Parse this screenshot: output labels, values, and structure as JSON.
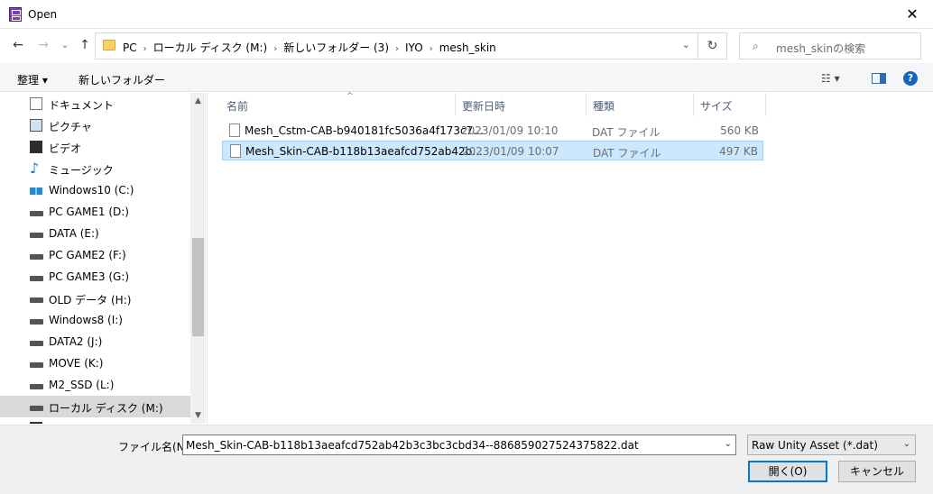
{
  "window": {
    "title": "Open",
    "close_glyph": "✕"
  },
  "nav": {
    "back": "←",
    "forward": "→",
    "recent": "⌄",
    "up": "↑",
    "breadcrumbs": [
      "PC",
      "ローカル ディスク (M:)",
      "新しいフォルダー (3)",
      "IYO",
      "mesh_skin"
    ],
    "separator": "›",
    "dropdown": "⌄",
    "refresh": "↻",
    "search_placeholder": "mesh_skinの検索",
    "search_glyph": "⌕"
  },
  "toolbar": {
    "organize": "整理 ▾",
    "new_folder": "新しいフォルダー",
    "view_glyph": "☷ ▾",
    "help": "?"
  },
  "sidebar": {
    "items": [
      {
        "label": "ドキュメント",
        "icon": "document-icon",
        "selected": false
      },
      {
        "label": "ピクチャ",
        "icon": "pictures-icon",
        "selected": false
      },
      {
        "label": "ビデオ",
        "icon": "videos-icon",
        "selected": false
      },
      {
        "label": "ミュージック",
        "icon": "music-icon",
        "selected": false
      },
      {
        "label": "Windows10 (C:)",
        "icon": "windows-drive-icon",
        "selected": false
      },
      {
        "label": "PC GAME1 (D:)",
        "icon": "drive-icon",
        "selected": false
      },
      {
        "label": "DATA (E:)",
        "icon": "drive-icon",
        "selected": false
      },
      {
        "label": "PC GAME2 (F:)",
        "icon": "drive-icon",
        "selected": false
      },
      {
        "label": "PC GAME3 (G:)",
        "icon": "drive-icon",
        "selected": false
      },
      {
        "label": "OLD データ (H:)",
        "icon": "drive-icon",
        "selected": false
      },
      {
        "label": "Windows8 (I:)",
        "icon": "drive-icon",
        "selected": false
      },
      {
        "label": "DATA2 (J:)",
        "icon": "drive-icon",
        "selected": false
      },
      {
        "label": "MOVE (K:)",
        "icon": "drive-icon",
        "selected": false
      },
      {
        "label": "M2_SSD (L:)",
        "icon": "drive-icon",
        "selected": false
      },
      {
        "label": "ローカル ディスク (M:)",
        "icon": "drive-icon",
        "selected": true
      }
    ],
    "scroll_up": "▲",
    "scroll_down": "▼"
  },
  "filelist": {
    "columns": [
      "名前",
      "更新日時",
      "種類",
      "サイズ"
    ],
    "sort_glyph": "^",
    "rows": [
      {
        "name": "Mesh_Cstm-CAB-b940181fc5036a4f173c7...",
        "date": "2023/01/09 10:10",
        "type": "DAT ファイル",
        "size": "560 KB",
        "selected": false
      },
      {
        "name": "Mesh_Skin-CAB-b118b13aeafcd752ab42b...",
        "date": "2023/01/09 10:07",
        "type": "DAT ファイル",
        "size": "497 KB",
        "selected": true
      }
    ]
  },
  "footer": {
    "filename_label": "ファイル名(N):",
    "filename_value": "Mesh_Skin-CAB-b118b13aeafcd752ab42b3c3bc3cbd34--886859027524375822.dat",
    "filename_dd": "⌄",
    "filter_value": "Raw Unity Asset (*.dat)",
    "filter_dd": "⌄",
    "open_label": "開く(O)",
    "cancel_label": "キャンセル"
  }
}
